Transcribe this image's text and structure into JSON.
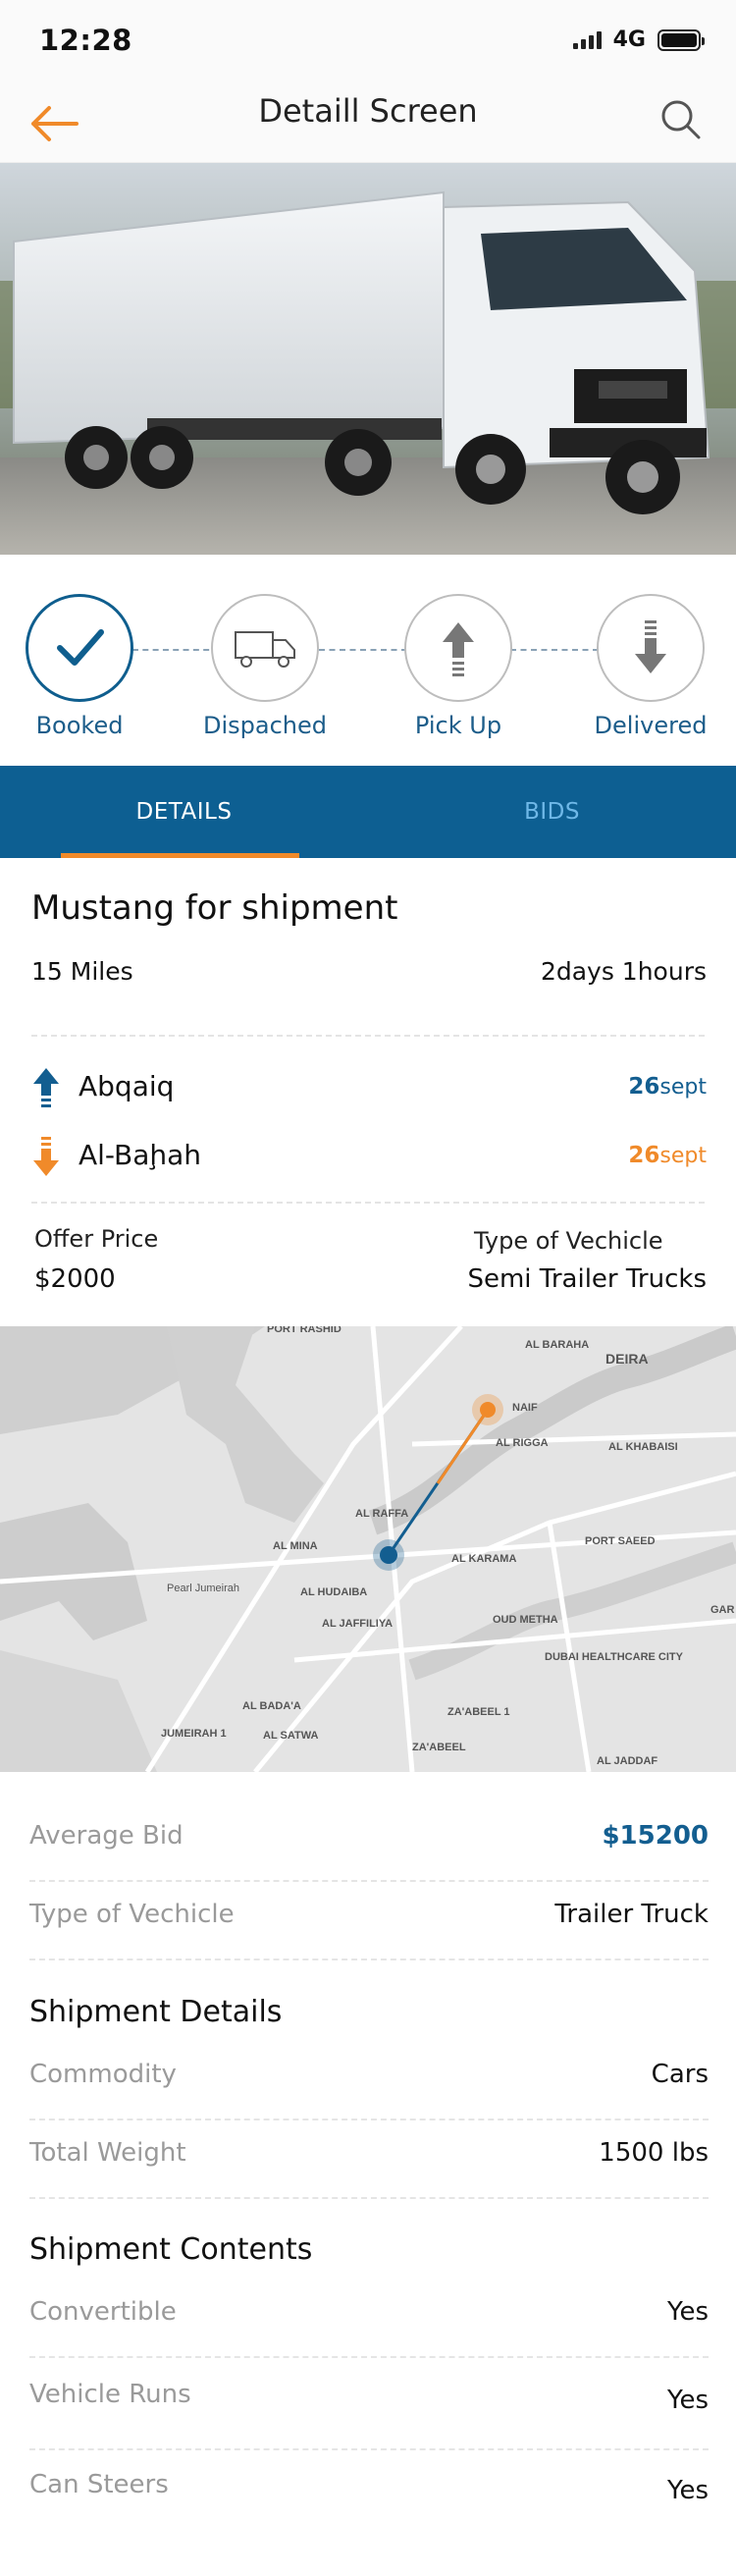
{
  "status_bar": {
    "time": "12:28",
    "network": "4G"
  },
  "header": {
    "title": "Detaill Screen",
    "back_icon": "arrow-left-icon",
    "search_icon": "search-icon",
    "accent": "#F08A2A"
  },
  "steps": [
    {
      "label": "Booked",
      "icon": "check-icon",
      "active": true
    },
    {
      "label": "Dispached",
      "icon": "truck-icon",
      "active": false
    },
    {
      "label": "Pick Up",
      "icon": "upload-arrow-icon",
      "active": false
    },
    {
      "label": "Delivered",
      "icon": "download-arrow-icon",
      "active": false
    }
  ],
  "tabs": [
    {
      "label": "DETAILS"
    },
    {
      "label": "BIDS"
    }
  ],
  "shipment": {
    "title": "Mustang for shipment",
    "distance": "15 Miles",
    "duration": "2days 1hours",
    "origin": {
      "name": "Abqaiq",
      "day": "26",
      "month": "sept",
      "color": "#135E90"
    },
    "destination": {
      "name": "Al-Baḩah",
      "day": "26",
      "month": "sept",
      "color": "#F08A2A"
    },
    "offer_price_label": "Offer Price",
    "offer_price": "$2000",
    "vehicle_type_label": "Type of Vechicle",
    "vehicle_type": "Semi Trailer Trucks"
  },
  "map": {
    "labels": [
      "PORT RASHID",
      "AL BARAHA",
      "DEIRA",
      "NAIF",
      "AL RIGGA",
      "AL KHABAISI",
      "AL RAFFA",
      "AL MINA",
      "AL KARAMA",
      "PORT SAEED",
      "Pearl Jumeirah",
      "AL HUDAIBA",
      "AL JAFFILIYA",
      "OUD METHA",
      "DUBAI HEALTHCARE CITY",
      "AL BADA'A",
      "AL SATWA",
      "JUMEIRAH 1",
      "ZA'ABEEL 1",
      "ZA'ABEEL",
      "AL JADDAF",
      "GAR"
    ]
  },
  "info": {
    "average_bid_label": "Average Bid",
    "average_bid": "$15200",
    "type_label": "Type of Vechicle",
    "type_value": "Trailer Truck",
    "shipment_details_title": "Shipment Details",
    "commodity_label": "Commodity",
    "commodity_value": "Cars",
    "weight_label": "Total Weight",
    "weight_value": "1500 lbs",
    "contents_title": "Shipment Contents",
    "convertible_label": "Convertible",
    "convertible_value": "Yes",
    "runs_label": "Vehicle Runs",
    "runs_value": "Yes",
    "steers_label": "Can Steers",
    "steers_value": "Yes"
  }
}
